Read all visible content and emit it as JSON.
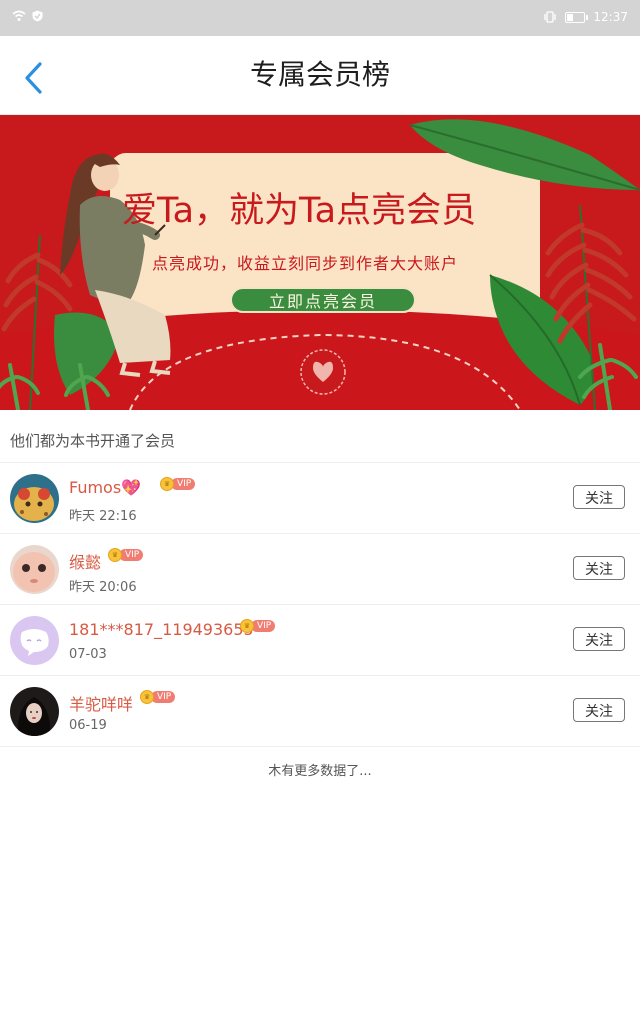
{
  "status": {
    "time": "12:37"
  },
  "header": {
    "title": "专属会员榜"
  },
  "banner": {
    "headline": "爱Ta，就为Ta点亮会员",
    "subline": "点亮成功，收益立刻同步到作者大大账户",
    "cta": "立即点亮会员"
  },
  "section": {
    "title": "他们都为本书开通了会员"
  },
  "members": [
    {
      "name": "Fumos💖",
      "time": "昨天 22:16",
      "vip": "VIP",
      "follow": "关注"
    },
    {
      "name": "缑懿",
      "time": "昨天 20:06",
      "vip": "VIP",
      "follow": "关注"
    },
    {
      "name": "181***817_119493655",
      "time": "07-03",
      "vip": "VIP",
      "follow": "关注"
    },
    {
      "name": "羊驼咩咩",
      "time": "06-19",
      "vip": "VIP",
      "follow": "关注"
    }
  ],
  "footer": {
    "no_more": "木有更多数据了..."
  },
  "colors": {
    "accent": "#2b8fe0",
    "banner_red": "#c8191d",
    "name_red": "#d85a44",
    "cta_green": "#3a8c3e"
  }
}
